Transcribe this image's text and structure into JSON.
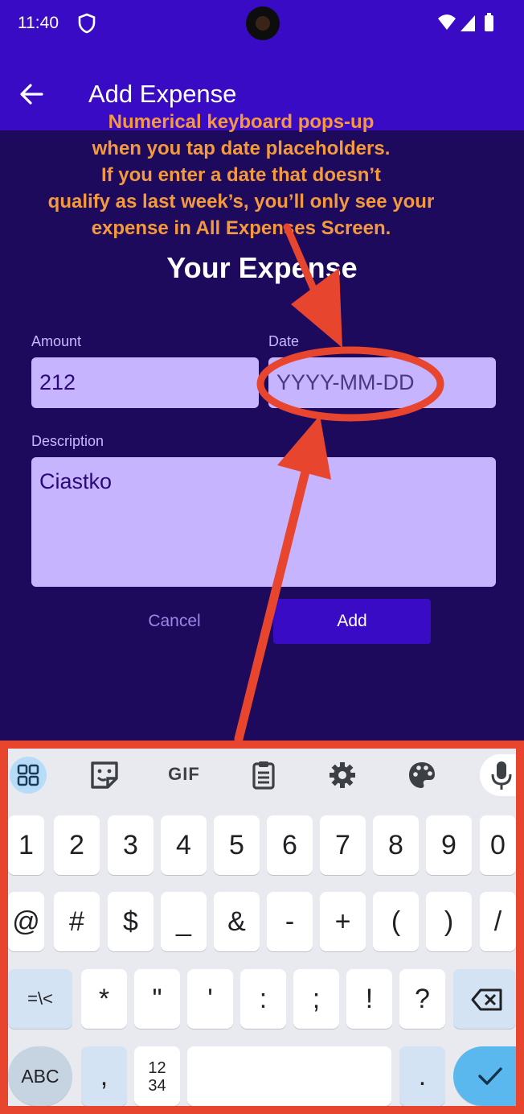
{
  "status_bar": {
    "time": "11:40"
  },
  "app_bar": {
    "title": "Add Expense"
  },
  "annotation": {
    "lines": [
      "Numerical keyboard pops-up",
      "when you tap date placeholders.",
      "If you enter a date that doesn’t",
      "qualify as last week’s, you’ll only see your",
      "expense in All Expenses Screen."
    ],
    "color": "#f59a3c",
    "highlight_color": "#e8452e"
  },
  "form": {
    "heading": "Your Expense",
    "amount": {
      "label": "Amount",
      "value": "212"
    },
    "date": {
      "label": "Date",
      "placeholder": "YYYY-MM-DD"
    },
    "description": {
      "label": "Description",
      "value": "Ciastko"
    },
    "cancel_label": "Cancel",
    "add_label": "Add"
  },
  "keyboard": {
    "toolbar": [
      "apps-grid-icon",
      "sticker-icon",
      "GIF",
      "clipboard-icon",
      "gear-icon",
      "palette-icon",
      "mic-icon"
    ],
    "gif_label": "GIF",
    "row1": [
      "1",
      "2",
      "3",
      "4",
      "5",
      "6",
      "7",
      "8",
      "9",
      "0"
    ],
    "row2": [
      "@",
      "#",
      "$",
      "_",
      "&",
      "-",
      "+",
      "(",
      ")",
      "/"
    ],
    "row3": [
      "=\\<",
      "*",
      "\"",
      "'",
      ":",
      ";",
      "!",
      "?"
    ],
    "row4": {
      "abc": "ABC",
      "comma": ",",
      "numpad_top": "12",
      "numpad_bottom": "34",
      "period": "."
    }
  },
  "colors": {
    "app_bar": "#3a0bc4",
    "background": "#1e0a5c",
    "field": "#c7b4ff",
    "add_button": "#3a0bc4"
  }
}
